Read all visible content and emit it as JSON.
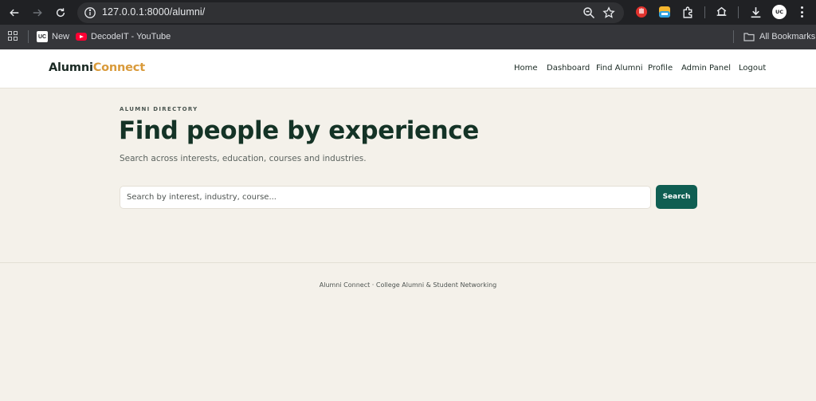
{
  "browser": {
    "url": "127.0.0.1:8000/alumni/",
    "bookmarks": [
      {
        "label": "New",
        "icon": "uc-favicon"
      },
      {
        "label": "DecodeIT - YouTube",
        "icon": "youtube-favicon"
      }
    ],
    "all_bookmarks_label": "All Bookmarks",
    "avatar_initials": "UC"
  },
  "site": {
    "brand_part1": "Alumni",
    "brand_part2": "Connect",
    "brand_accent_color": "#d99a3a",
    "nav": {
      "home": "Home",
      "dashboard": "Dashboard",
      "find_alumni": "Find Alumni",
      "profile": "Profile",
      "admin_panel": "Admin Panel",
      "logout": "Logout"
    }
  },
  "main": {
    "eyebrow": "ALUMNI DIRECTORY",
    "title": "Find people by experience",
    "subtitle": "Search across interests, education, courses and industries.",
    "search_placeholder": "Search by interest, industry, course...",
    "search_button": "Search",
    "primary_color": "#0f5e52"
  },
  "footer": {
    "text": "Alumni Connect · College Alumni & Student Networking"
  }
}
